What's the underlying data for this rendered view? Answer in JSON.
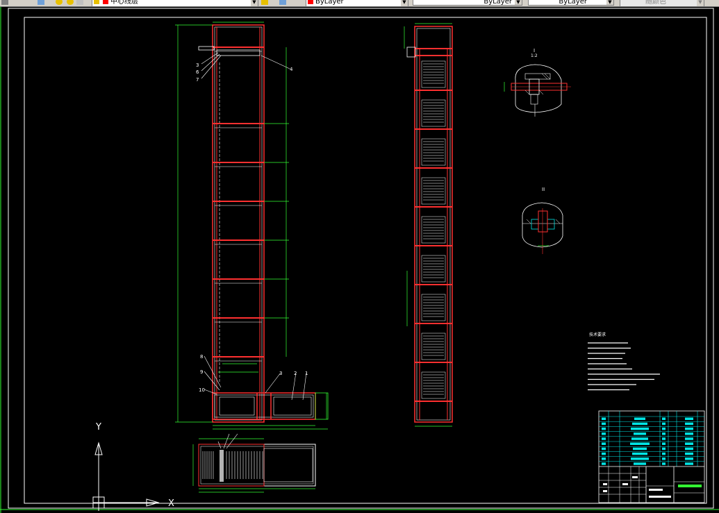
{
  "toolbar": {
    "layer_name": "中心线层",
    "color_value": "ByLayer",
    "linetype_value": "ByLayer",
    "lineweight_value": "ByLayer",
    "plotstyle_value": "随颜色"
  },
  "colors": {
    "background": "#000000",
    "frame": "#ff3030",
    "frame_inner": "#ffffff",
    "dimension": "#33ff33",
    "table": "#00e5e5",
    "border": "#ffffff",
    "red_swatch": "#ff0000"
  },
  "drawing": {
    "leaders_front": [
      "3",
      "6",
      "7",
      "4",
      "8",
      "9",
      "10",
      "3",
      "2",
      "1"
    ],
    "detail_labels": [
      "I",
      "1:2",
      "II"
    ],
    "notes_title": "技术要求"
  },
  "ucs_icon": {
    "x_label": "X",
    "y_label": "Y"
  }
}
